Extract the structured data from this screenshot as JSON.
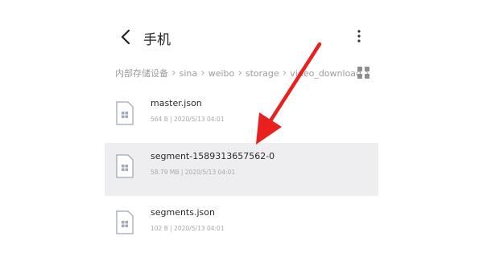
{
  "header": {
    "title": "手机",
    "back_icon": "chevron-left-icon",
    "more_icon": "more-vertical-icon"
  },
  "breadcrumb": {
    "items": [
      "内部存储设备",
      "sina",
      "weibo",
      "storage",
      "video_download"
    ],
    "view_toggle_icon": "grid-view-icon"
  },
  "files": [
    {
      "name": "master.json",
      "meta": "564 B | 2020/5/13 04:01",
      "icon": "file-icon",
      "selected": false
    },
    {
      "name": "segment-1589313657562-0",
      "meta": "58.79 MB | 2020/5/13 04:01",
      "icon": "file-icon",
      "selected": true
    },
    {
      "name": "segments.json",
      "meta": "102 B | 2020/5/13 04:01",
      "icon": "file-icon",
      "selected": false
    }
  ],
  "colors": {
    "annotation_arrow": "#e8201e",
    "selected_row": "#eeedf0",
    "icon_stroke": "#a0a8b8"
  }
}
